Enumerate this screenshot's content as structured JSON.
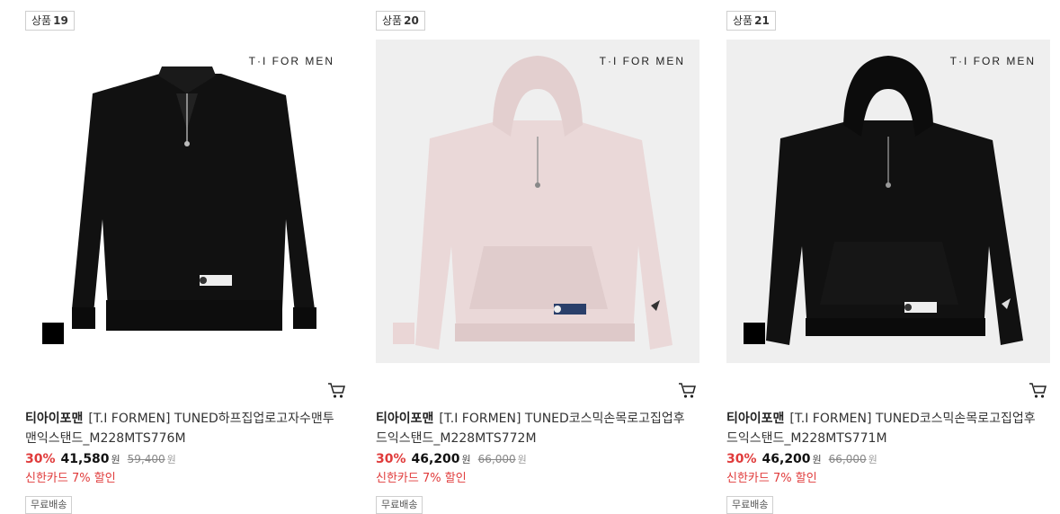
{
  "products": [
    {
      "rank_prefix": "상품",
      "rank_number": "19",
      "brand_mark": "T·I FOR MEN",
      "brand": "티아이포맨",
      "title": "[T.I FORMEN] TUNED하프집업로고자수맨투맨익스탠드_M228MTS776M",
      "discount_rate": "30%",
      "sale_price": "41,580",
      "currency": "원",
      "original_price": "59,400",
      "card_promo": "신한카드 7% 할인",
      "shipping": "무료배송",
      "swatch_color": "#000000",
      "garment_color": "#111111",
      "background": "white"
    },
    {
      "rank_prefix": "상품",
      "rank_number": "20",
      "brand_mark": "T·I FOR MEN",
      "brand": "티아이포맨",
      "title": "[T.I FORMEN] TUNED코스믹손목로고집업후드익스탠드_M228MTS772M",
      "discount_rate": "30%",
      "sale_price": "46,200",
      "currency": "원",
      "original_price": "66,000",
      "card_promo": "신한카드 7% 할인",
      "shipping": "무료배송",
      "swatch_color": "#ead6d6",
      "garment_color": "#ead8d8",
      "background": "gray"
    },
    {
      "rank_prefix": "상품",
      "rank_number": "21",
      "brand_mark": "T·I FOR MEN",
      "brand": "티아이포맨",
      "title": "[T.I FORMEN] TUNED코스믹손목로고집업후드익스탠드_M228MTS771M",
      "discount_rate": "30%",
      "sale_price": "46,200",
      "currency": "원",
      "original_price": "66,000",
      "card_promo": "신한카드 7% 할인",
      "shipping": "무료배송",
      "swatch_color": "#000000",
      "garment_color": "#111111",
      "background": "gray"
    }
  ],
  "colors": {
    "discount": "#e03b3b",
    "border": "#cfcfcf"
  },
  "icons": {
    "cart": "cart-icon"
  }
}
